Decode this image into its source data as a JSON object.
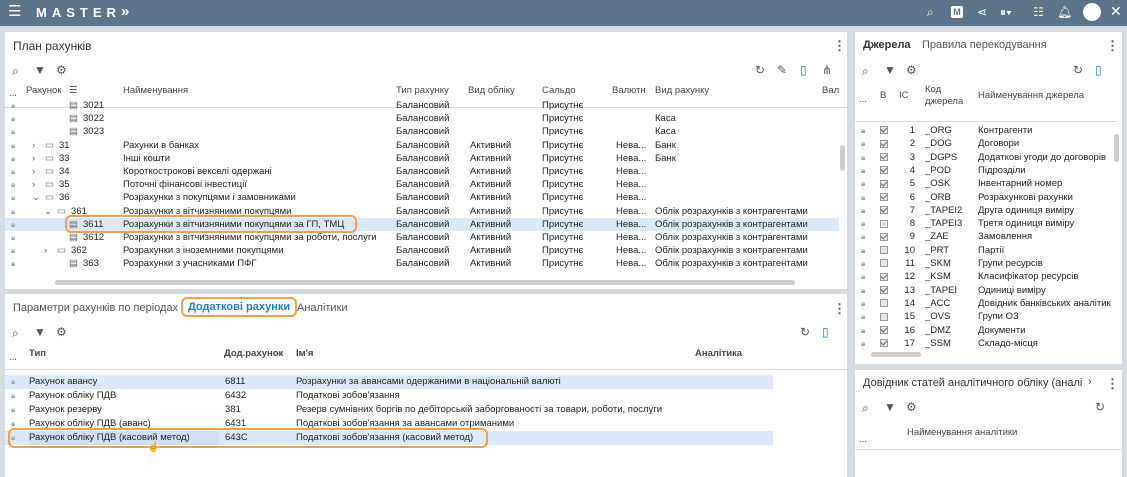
{
  "app": {
    "title": "MASTER",
    "chevron": "»"
  },
  "plan": {
    "title": "План рахунків",
    "columns": [
      "Рахунок",
      "Найменування",
      "Тип рахунку",
      "Вид обліку",
      "Сальдо",
      "Валютн",
      "Вид рахунку",
      "Вал"
    ],
    "rows": [
      {
        "code": "3021",
        "name": "",
        "type": "Балансовий",
        "acc": "",
        "saldo": "Присутнє",
        "cur": "",
        "kind": ""
      },
      {
        "code": "3022",
        "name": "",
        "type": "Балансовий",
        "acc": "",
        "saldo": "Присутнє",
        "cur": "",
        "kind": "Каса"
      },
      {
        "code": "3023",
        "name": "",
        "type": "Балансовий",
        "acc": "",
        "saldo": "Присутнє",
        "cur": "",
        "kind": "Каса"
      },
      {
        "code": "31",
        "name": "Рахунки в банках",
        "type": "Балансовий",
        "acc": "Активний",
        "saldo": "Присутнє",
        "cur": "Нева...",
        "kind": "Банк"
      },
      {
        "code": "33",
        "name": "Інші кошти",
        "type": "Балансовий",
        "acc": "Активний",
        "saldo": "Присутнє",
        "cur": "Нева...",
        "kind": "Банк"
      },
      {
        "code": "34",
        "name": "Короткострокові векселі одержані",
        "type": "Балансовий",
        "acc": "Активний",
        "saldo": "Присутнє",
        "cur": "Нева...",
        "kind": ""
      },
      {
        "code": "35",
        "name": "Поточні фінансові інвестиції",
        "type": "Балансовий",
        "acc": "Активний",
        "saldo": "Присутнє",
        "cur": "Нева...",
        "kind": ""
      },
      {
        "code": "36",
        "name": "Розрахунки з покупцями і замовниками",
        "type": "Балансовий",
        "acc": "Активний",
        "saldo": "Присутнє",
        "cur": "Нева...",
        "kind": ""
      },
      {
        "code": "361",
        "name": "Розрахунки з вітчизняними покупцями",
        "type": "Балансовий",
        "acc": "Активний",
        "saldo": "Присутнє",
        "cur": "Нева...",
        "kind": "Облік розрахунків з контрагентами"
      },
      {
        "code": "3611",
        "name": "Розрахунки з вітчизняними покупцями за ГП, ТМЦ",
        "type": "Балансовий",
        "acc": "Активний",
        "saldo": "Присутнє",
        "cur": "Нева...",
        "kind": "Облік розрахунків з контрагентами"
      },
      {
        "code": "3612",
        "name": "Розрахунки з вітчизняними покупцями за роботи, послуги",
        "type": "Балансовий",
        "acc": "Активний",
        "saldo": "Присутнє",
        "cur": "Нева...",
        "kind": "Облік розрахунків з контрагентами"
      },
      {
        "code": "362",
        "name": "Розрахунки з іноземними покупцями",
        "type": "Балансовий",
        "acc": "Активний",
        "saldo": "Присутнє",
        "cur": "Нева...",
        "kind": "Облік розрахунків з контрагентами"
      },
      {
        "code": "363",
        "name": "Розрахунки з учасниками ПФГ",
        "type": "Балансовий",
        "acc": "Активний",
        "saldo": "Присутнє",
        "cur": "Нева...",
        "kind": "Облік розрахунків з контрагентами"
      }
    ]
  },
  "additional": {
    "tabs": [
      "Параметри рахунків по періодах",
      "Додаткові рахунки",
      "Аналітики"
    ],
    "columns": [
      "Тип",
      "Дод.рахунок",
      "Ім'я",
      "Аналітика"
    ],
    "rows": [
      {
        "type": "Рахунок авансу",
        "acc": "6811",
        "name": "Розрахунки за авансами одержаними в національній валюті"
      },
      {
        "type": "Рахунок обліку ПДВ",
        "acc": "6432",
        "name": "Податкові зобов'язання"
      },
      {
        "type": "Рахунок резерву",
        "acc": "381",
        "name": "Резерв сумнівних боргів по дебіторській заборгованості за товари, роботи, послуги"
      },
      {
        "type": "Рахунок обліку ПДВ (аванс)",
        "acc": "6431",
        "name": "Податкові зобов'язання за авансами отриманими"
      },
      {
        "type": "Рахунок обліку ПДВ (касовий метод)",
        "acc": "643С",
        "name": "Податкові зобов'язання (касовий метод)"
      }
    ]
  },
  "sources": {
    "tabs": [
      "Джерела",
      "Правила перекодування"
    ],
    "columns": [
      "В",
      "ІС",
      "Код джерела",
      "Найменування джерела"
    ],
    "rows": [
      {
        "n": "1",
        "code": "_ORG",
        "name": "Контрагенти",
        "on": true
      },
      {
        "n": "2",
        "code": "_DOG",
        "name": "Договори",
        "on": true
      },
      {
        "n": "3",
        "code": "_DGPS",
        "name": "Додаткові угоди до договорів",
        "on": true
      },
      {
        "n": "4",
        "code": "_POD",
        "name": "Підрозділи",
        "on": true
      },
      {
        "n": "5",
        "code": "_OSK",
        "name": "Інвентарний номер",
        "on": true
      },
      {
        "n": "6",
        "code": "_ORB",
        "name": "Розрахункові рахунки",
        "on": true
      },
      {
        "n": "7",
        "code": "_TAPEI2",
        "name": "Друга одиниця виміру",
        "on": true
      },
      {
        "n": "8",
        "code": "_TAPEI3",
        "name": "Третя одиниця виміру",
        "on": false
      },
      {
        "n": "9",
        "code": "_ZAE",
        "name": "Замовлення",
        "on": true
      },
      {
        "n": "10",
        "code": "_PRT",
        "name": "Партії",
        "on": false
      },
      {
        "n": "11",
        "code": "_SKM",
        "name": "Групи ресурсів",
        "on": false
      },
      {
        "n": "12",
        "code": "_KSM",
        "name": "Класифікатор ресурсів",
        "on": true
      },
      {
        "n": "13",
        "code": "_TAPEI",
        "name": "Одиниці виміру",
        "on": true
      },
      {
        "n": "14",
        "code": "_ACC",
        "name": "Довідник банківських аналітик",
        "on": false
      },
      {
        "n": "15",
        "code": "_OVS",
        "name": "Групи ОЗ",
        "on": false
      },
      {
        "n": "16",
        "code": "_DMZ",
        "name": "Документи",
        "on": true
      },
      {
        "n": "17",
        "code": "_SSM",
        "name": "Складо-місця",
        "on": true
      }
    ]
  },
  "analytics": {
    "title": "Довідник статей аналітичного обліку (аналі",
    "column": "Найменування аналітики"
  }
}
